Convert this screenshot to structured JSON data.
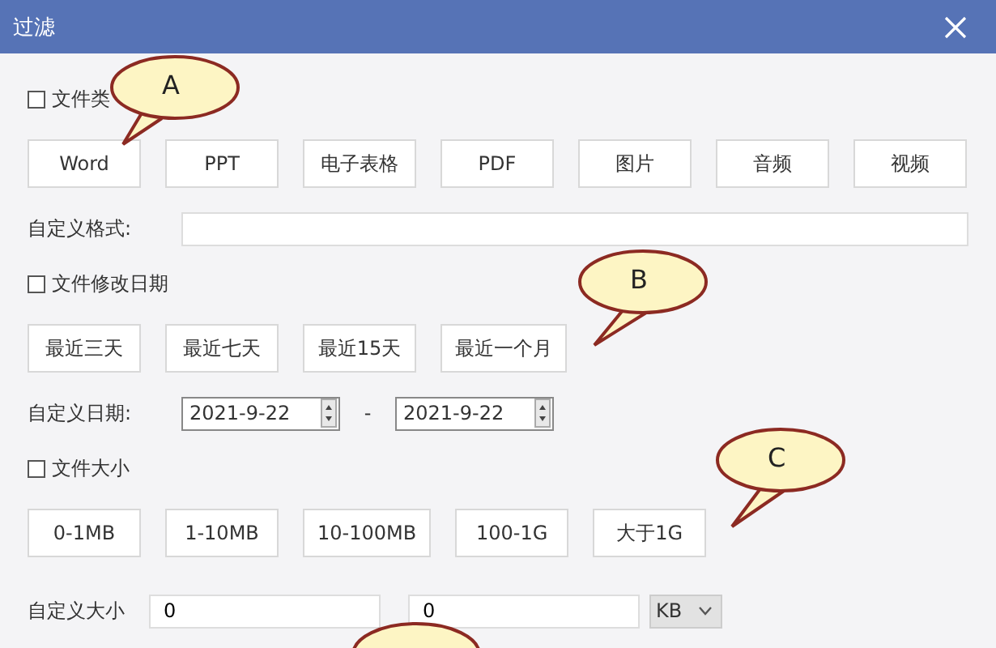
{
  "window": {
    "title": "过滤"
  },
  "file_type": {
    "label": "文件类",
    "checked": false,
    "options": [
      "Word",
      "PPT",
      "电子表格",
      "PDF",
      "图片",
      "音频",
      "视频"
    ],
    "custom_label": "自定义格式:"
  },
  "modified_date": {
    "label": "文件修改日期",
    "checked": false,
    "options": [
      "最近三天",
      "最近七天",
      "最近15天",
      "最近一个月"
    ],
    "custom_label": "自定义日期:",
    "from": "2021-9-22",
    "separator": "-",
    "to": "2021-9-22"
  },
  "file_size": {
    "label": "文件大小",
    "checked": false,
    "options": [
      "0-1MB",
      "1-10MB",
      "10-100MB",
      "100-1G",
      "大于1G"
    ],
    "custom_label": "自定义大小",
    "min": "0",
    "max": "0",
    "unit": "KB"
  },
  "callouts": [
    {
      "letter": "A"
    },
    {
      "letter": "B"
    },
    {
      "letter": "C"
    }
  ]
}
